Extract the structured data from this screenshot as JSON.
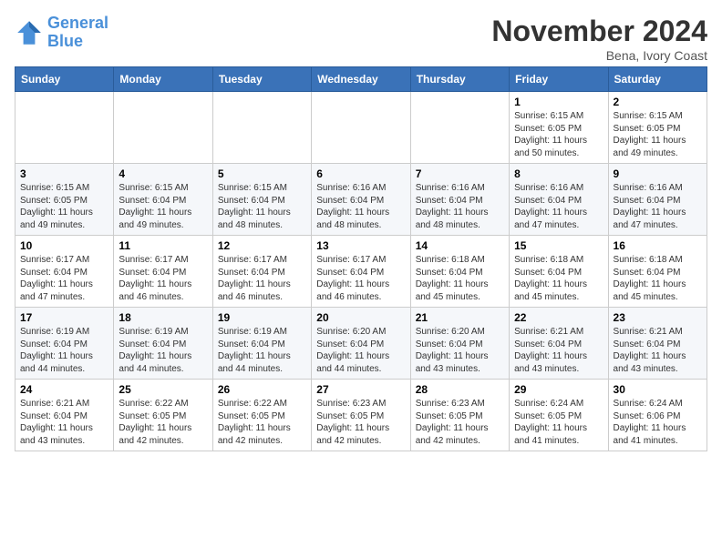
{
  "header": {
    "logo_line1": "General",
    "logo_line2": "Blue",
    "month": "November 2024",
    "location": "Bena, Ivory Coast"
  },
  "weekdays": [
    "Sunday",
    "Monday",
    "Tuesday",
    "Wednesday",
    "Thursday",
    "Friday",
    "Saturday"
  ],
  "weeks": [
    [
      {
        "day": "",
        "info": ""
      },
      {
        "day": "",
        "info": ""
      },
      {
        "day": "",
        "info": ""
      },
      {
        "day": "",
        "info": ""
      },
      {
        "day": "",
        "info": ""
      },
      {
        "day": "1",
        "info": "Sunrise: 6:15 AM\nSunset: 6:05 PM\nDaylight: 11 hours and 50 minutes."
      },
      {
        "day": "2",
        "info": "Sunrise: 6:15 AM\nSunset: 6:05 PM\nDaylight: 11 hours and 49 minutes."
      }
    ],
    [
      {
        "day": "3",
        "info": "Sunrise: 6:15 AM\nSunset: 6:05 PM\nDaylight: 11 hours and 49 minutes."
      },
      {
        "day": "4",
        "info": "Sunrise: 6:15 AM\nSunset: 6:04 PM\nDaylight: 11 hours and 49 minutes."
      },
      {
        "day": "5",
        "info": "Sunrise: 6:15 AM\nSunset: 6:04 PM\nDaylight: 11 hours and 48 minutes."
      },
      {
        "day": "6",
        "info": "Sunrise: 6:16 AM\nSunset: 6:04 PM\nDaylight: 11 hours and 48 minutes."
      },
      {
        "day": "7",
        "info": "Sunrise: 6:16 AM\nSunset: 6:04 PM\nDaylight: 11 hours and 48 minutes."
      },
      {
        "day": "8",
        "info": "Sunrise: 6:16 AM\nSunset: 6:04 PM\nDaylight: 11 hours and 47 minutes."
      },
      {
        "day": "9",
        "info": "Sunrise: 6:16 AM\nSunset: 6:04 PM\nDaylight: 11 hours and 47 minutes."
      }
    ],
    [
      {
        "day": "10",
        "info": "Sunrise: 6:17 AM\nSunset: 6:04 PM\nDaylight: 11 hours and 47 minutes."
      },
      {
        "day": "11",
        "info": "Sunrise: 6:17 AM\nSunset: 6:04 PM\nDaylight: 11 hours and 46 minutes."
      },
      {
        "day": "12",
        "info": "Sunrise: 6:17 AM\nSunset: 6:04 PM\nDaylight: 11 hours and 46 minutes."
      },
      {
        "day": "13",
        "info": "Sunrise: 6:17 AM\nSunset: 6:04 PM\nDaylight: 11 hours and 46 minutes."
      },
      {
        "day": "14",
        "info": "Sunrise: 6:18 AM\nSunset: 6:04 PM\nDaylight: 11 hours and 45 minutes."
      },
      {
        "day": "15",
        "info": "Sunrise: 6:18 AM\nSunset: 6:04 PM\nDaylight: 11 hours and 45 minutes."
      },
      {
        "day": "16",
        "info": "Sunrise: 6:18 AM\nSunset: 6:04 PM\nDaylight: 11 hours and 45 minutes."
      }
    ],
    [
      {
        "day": "17",
        "info": "Sunrise: 6:19 AM\nSunset: 6:04 PM\nDaylight: 11 hours and 44 minutes."
      },
      {
        "day": "18",
        "info": "Sunrise: 6:19 AM\nSunset: 6:04 PM\nDaylight: 11 hours and 44 minutes."
      },
      {
        "day": "19",
        "info": "Sunrise: 6:19 AM\nSunset: 6:04 PM\nDaylight: 11 hours and 44 minutes."
      },
      {
        "day": "20",
        "info": "Sunrise: 6:20 AM\nSunset: 6:04 PM\nDaylight: 11 hours and 44 minutes."
      },
      {
        "day": "21",
        "info": "Sunrise: 6:20 AM\nSunset: 6:04 PM\nDaylight: 11 hours and 43 minutes."
      },
      {
        "day": "22",
        "info": "Sunrise: 6:21 AM\nSunset: 6:04 PM\nDaylight: 11 hours and 43 minutes."
      },
      {
        "day": "23",
        "info": "Sunrise: 6:21 AM\nSunset: 6:04 PM\nDaylight: 11 hours and 43 minutes."
      }
    ],
    [
      {
        "day": "24",
        "info": "Sunrise: 6:21 AM\nSunset: 6:04 PM\nDaylight: 11 hours and 43 minutes."
      },
      {
        "day": "25",
        "info": "Sunrise: 6:22 AM\nSunset: 6:05 PM\nDaylight: 11 hours and 42 minutes."
      },
      {
        "day": "26",
        "info": "Sunrise: 6:22 AM\nSunset: 6:05 PM\nDaylight: 11 hours and 42 minutes."
      },
      {
        "day": "27",
        "info": "Sunrise: 6:23 AM\nSunset: 6:05 PM\nDaylight: 11 hours and 42 minutes."
      },
      {
        "day": "28",
        "info": "Sunrise: 6:23 AM\nSunset: 6:05 PM\nDaylight: 11 hours and 42 minutes."
      },
      {
        "day": "29",
        "info": "Sunrise: 6:24 AM\nSunset: 6:05 PM\nDaylight: 11 hours and 41 minutes."
      },
      {
        "day": "30",
        "info": "Sunrise: 6:24 AM\nSunset: 6:06 PM\nDaylight: 11 hours and 41 minutes."
      }
    ]
  ]
}
